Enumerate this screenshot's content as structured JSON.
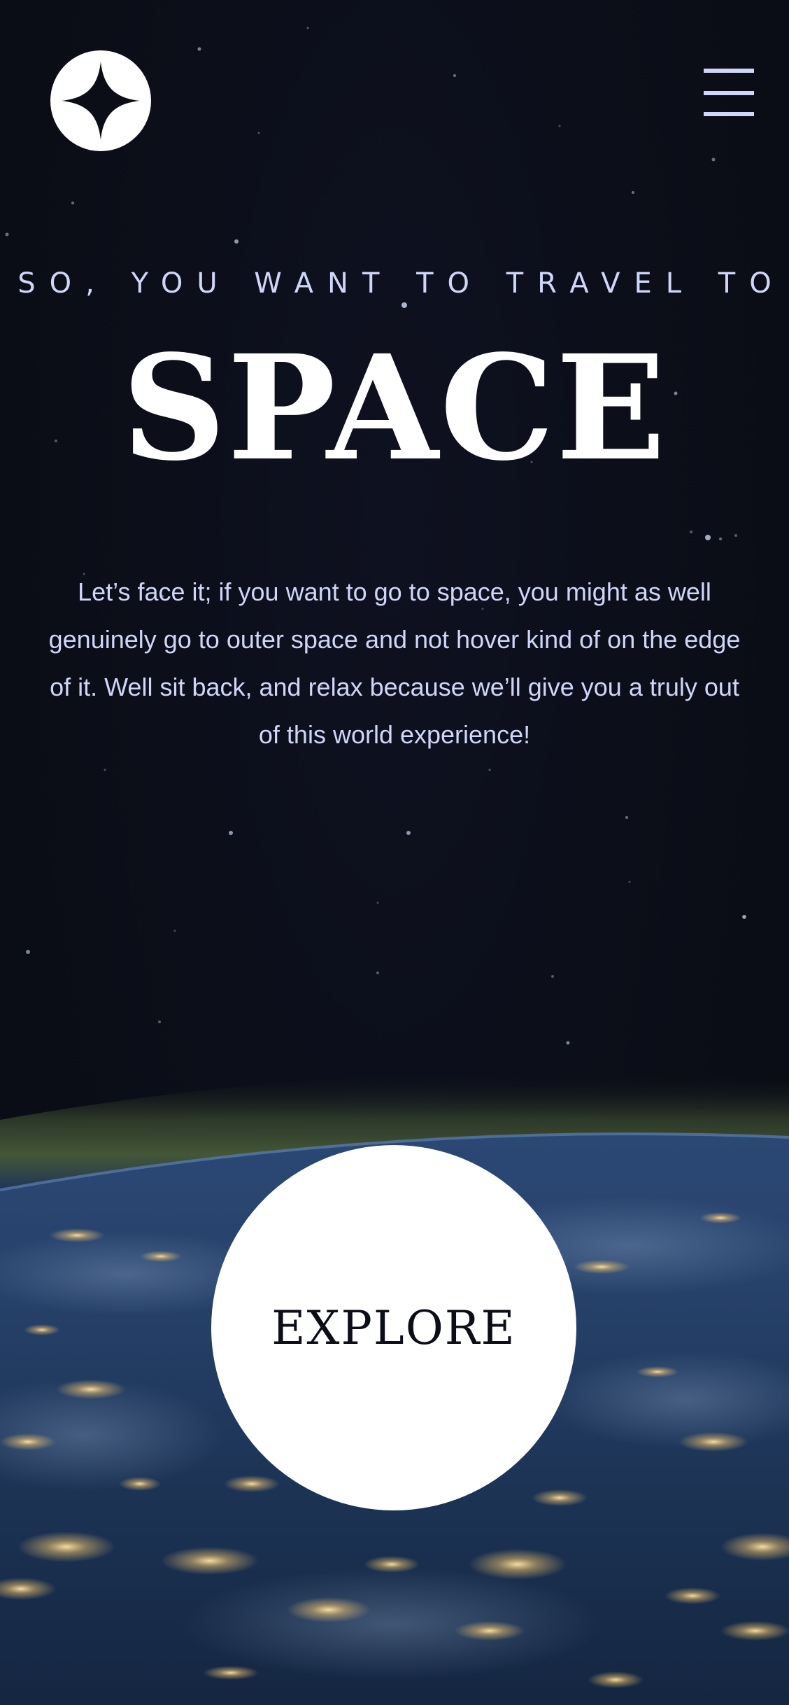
{
  "header": {
    "logo_icon": "four-point-star-icon",
    "menu_icon": "hamburger-menu-icon"
  },
  "hero": {
    "subtitle": "SO, YOU WANT TO TRAVEL TO",
    "title": "SPACE",
    "description": "Let’s face it; if you want to go to space, you might as well genuinely go to outer space and not hover kind of on the edge of it. Well sit back, and relax because we’ll give you a truly out of this world experience!",
    "explore_label": "EXPLORE"
  },
  "colors": {
    "background": "#0b0d17",
    "accent_text": "#d0d6f9",
    "white": "#ffffff"
  }
}
